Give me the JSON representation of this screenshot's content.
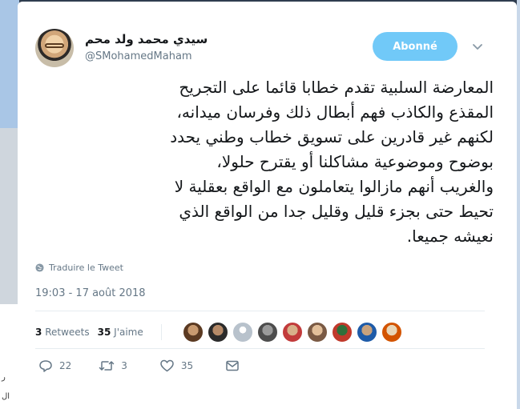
{
  "user": {
    "display_name": "سيدي محمد ولد محم",
    "handle": "@SMohamedMaham"
  },
  "follow_button": {
    "label": "Abonné"
  },
  "tweet": {
    "lines": [
      "المعارضة السلبية تقدم خطابا قائما على التجريح",
      "المقذع والكاذب فهم أبطال ذلك وفرسان ميدانه،",
      "لكنهم غير قادرين على تسويق خطاب وطني يحدد",
      "بوضوح وموضوعية مشاكلنا أو يقترح حلولا،",
      "والغريب أنهم مازالوا يتعاملون مع الواقع بعقلية لا",
      "تحيط حتى بجزء قليل وقليل جدا من الواقع الذي",
      "نعيشه جميعا."
    ],
    "translate_label": "Traduire le Tweet",
    "timestamp": "19:03 - 17 août 2018"
  },
  "stats": {
    "retweets_count": "3",
    "retweets_label": "Retweets",
    "likes_count": "35",
    "likes_label": "J'aime"
  },
  "actions": {
    "reply_count": "22",
    "retweet_count": "3",
    "like_count": "35"
  },
  "background_fragments": [
    "ر",
    "ال"
  ],
  "colors": {
    "follow_button": "#71c9f8",
    "text_primary": "#14171a",
    "text_secondary": "#657786"
  }
}
